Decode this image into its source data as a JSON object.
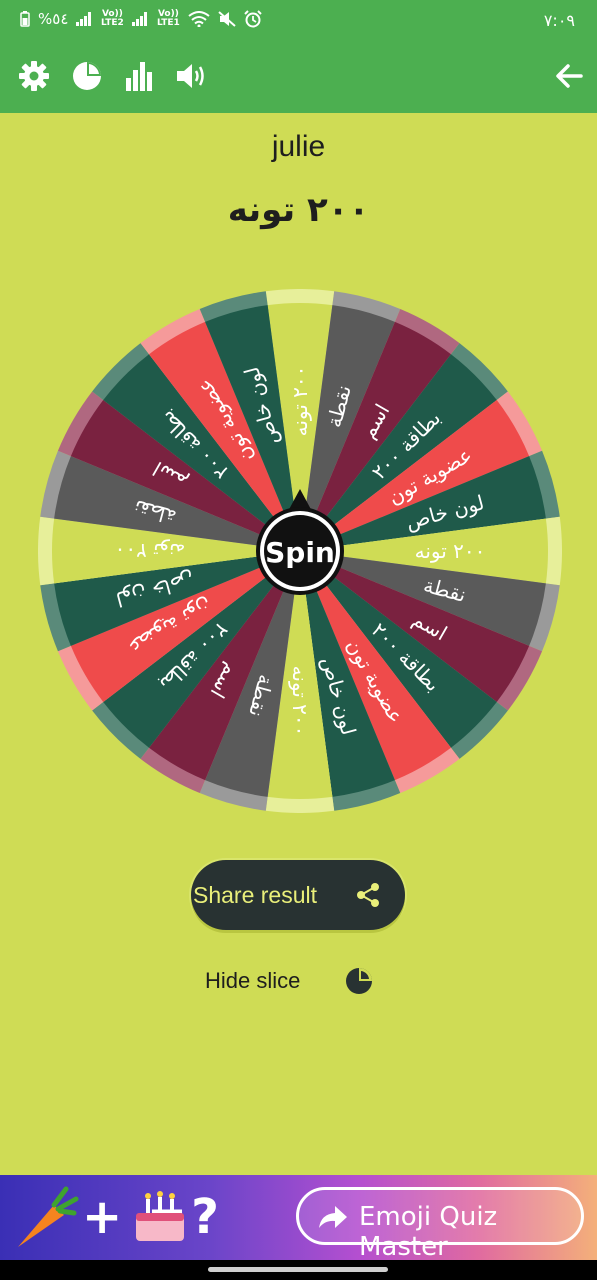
{
  "status_bar": {
    "battery": "%٥٤",
    "sim2_label": "Vo)) LTE2",
    "sim1_label": "Vo)) LTE1",
    "time": "٧:٠٩"
  },
  "toolbar": {
    "icons": [
      "gear-icon",
      "pie-chart-icon",
      "bar-chart-icon",
      "speaker-icon",
      "back-arrow-icon"
    ]
  },
  "wheel_title": "julie",
  "result_text": "٢٠٠ تونه",
  "wheel": {
    "center_label": "Spin",
    "slices": [
      {
        "label": "٢٠٠ تونه",
        "color": "#cfdc55",
        "rim": "#e7ef9a"
      },
      {
        "label": "نقطة",
        "color": "#5a5a5a",
        "rim": "#9a9a9a"
      },
      {
        "label": "اسم",
        "color": "#7a2240",
        "rim": "#b06880"
      },
      {
        "label": "بطاقة ٢٠٠",
        "color": "#1f5a4a",
        "rim": "#5a8a7a"
      },
      {
        "label": "عضوية تون",
        "color": "#ef4b4b",
        "rim": "#f59a9a"
      },
      {
        "label": "لون خاص",
        "color": "#1f5a4a",
        "rim": "#5a8a7a"
      },
      {
        "label": "٢٠٠ تونه",
        "color": "#cfdc55",
        "rim": "#e7ef9a"
      },
      {
        "label": "نقطة",
        "color": "#5a5a5a",
        "rim": "#9a9a9a"
      },
      {
        "label": "اسم",
        "color": "#7a2240",
        "rim": "#b06880"
      },
      {
        "label": "بطاقة ٢٠٠",
        "color": "#1f5a4a",
        "rim": "#5a8a7a"
      },
      {
        "label": "عضوية تون",
        "color": "#ef4b4b",
        "rim": "#f59a9a"
      },
      {
        "label": "لون خاص",
        "color": "#1f5a4a",
        "rim": "#5a8a7a"
      },
      {
        "label": "٢٠٠ تونه",
        "color": "#cfdc55",
        "rim": "#e7ef9a"
      },
      {
        "label": "نقطة",
        "color": "#5a5a5a",
        "rim": "#9a9a9a"
      },
      {
        "label": "اسم",
        "color": "#7a2240",
        "rim": "#b06880"
      },
      {
        "label": "بطاقة ٢٠٠",
        "color": "#1f5a4a",
        "rim": "#5a8a7a"
      },
      {
        "label": "عضوية تون",
        "color": "#ef4b4b",
        "rim": "#f59a9a"
      },
      {
        "label": "لون خاص",
        "color": "#1f5a4a",
        "rim": "#5a8a7a"
      },
      {
        "label": "٢٠٠ تونه",
        "color": "#cfdc55",
        "rim": "#e7ef9a"
      },
      {
        "label": "نقطة",
        "color": "#5a5a5a",
        "rim": "#9a9a9a"
      },
      {
        "label": "اسم",
        "color": "#7a2240",
        "rim": "#b06880"
      },
      {
        "label": "بطاقة ٢٠٠",
        "color": "#1f5a4a",
        "rim": "#5a8a7a"
      },
      {
        "label": "عضوية تون",
        "color": "#ef4b4b",
        "rim": "#f59a9a"
      },
      {
        "label": "لون خاص",
        "color": "#1f5a4a",
        "rim": "#5a8a7a"
      }
    ]
  },
  "share_button": {
    "label": "Share result"
  },
  "hide_slice": {
    "label": "Hide slice"
  },
  "ad_banner": {
    "equation": "+ =?",
    "button_label": "Emoji Quiz Master"
  },
  "colors": {
    "background": "#cfdc55",
    "toolbar": "#4caf50",
    "button_bg": "#283232",
    "button_text": "#e9ef7a"
  }
}
